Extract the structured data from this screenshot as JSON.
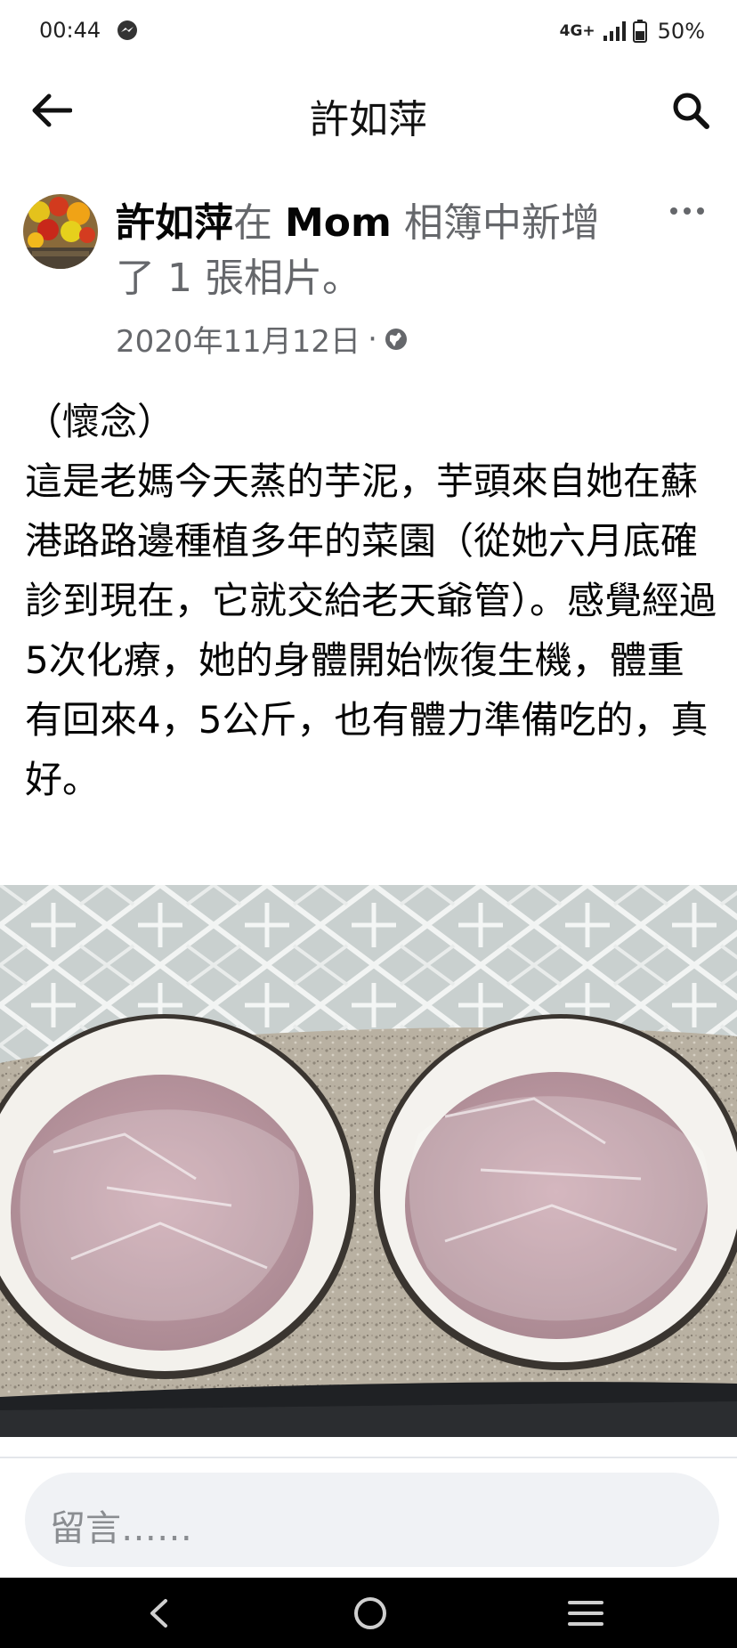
{
  "status_bar": {
    "time": "00:44",
    "network": "4G+",
    "battery": "50%"
  },
  "header": {
    "title": "許如萍"
  },
  "post": {
    "author": "許如萍",
    "action_prefix": "在 ",
    "album": "Mom",
    "action_suffix": " 相簿中新增了 1 張相片。",
    "date": "2020年11月12日",
    "date_separator": "·",
    "privacy_icon": "globe-icon",
    "body": "（懷念）\n這是老媽今天蒸的芋泥，芋頭來自她在蘇港路路邊種植多年的菜園（從她六月底確診到現在，它就交給老天爺管）。感覺經過5次化療，她的身體開始恢復生機，體重有回來4，5公斤，也有體力準備吃的，真好。"
  },
  "comment": {
    "placeholder": "留言……"
  },
  "icons": {
    "back": "arrow-left-icon",
    "search": "search-icon",
    "more": "more-icon"
  },
  "colors": {
    "secondary_text": "#65676b",
    "primary_text": "#050505",
    "comment_bg": "#f0f2f5"
  }
}
